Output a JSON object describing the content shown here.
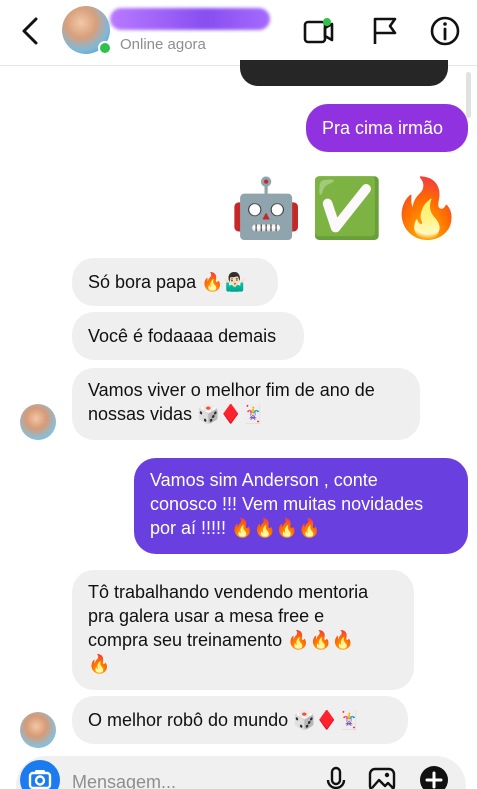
{
  "header": {
    "status": "Online agora"
  },
  "messages": {
    "m1": "Pra cima irmão",
    "m2": "Só bora papa 🔥🤷🏻‍♂️",
    "m3": "Você é fodaaaa demais",
    "m4_line1": "Vamos viver o melhor fim de ano de",
    "m4_line2": "nossas vidas 🎲♦️🃏",
    "m5_line1": "Vamos sim Anderson , conte",
    "m5_line2": "conosco !!! Vem muitas novidades",
    "m5_line3": "por aí !!!!! 🔥🔥🔥🔥",
    "m6_line1": "Tô trabalhando vendendo mentoria",
    "m6_line2": "pra galera usar a mesa free e",
    "m6_line3": "compra seu treinamento 🔥🔥🔥",
    "m6_line4": "🔥",
    "m7": "O melhor robô do mundo 🎲♦️🃏"
  },
  "reaction_emojis": [
    "🤖",
    "✅",
    "🔥"
  ],
  "composer": {
    "placeholder": "Mensagem..."
  },
  "colors": {
    "outgoing_purple": "#9032e0",
    "outgoing_indigo": "#6a3fe0",
    "incoming_gray": "#efefef",
    "online_green": "#2fc24a",
    "camera_blue": "#1d7bf0"
  }
}
